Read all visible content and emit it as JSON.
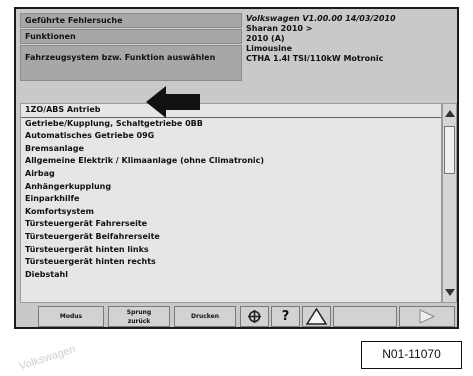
{
  "header": {
    "left": [
      "Geführte Fehlersuche",
      "Funktionen",
      "Fahrzeugsystem bzw. Funktion auswählen"
    ],
    "right": [
      "Volkswagen V1.00.00  14/03/2010",
      "Sharan 2010 >",
      "2010 (A)",
      "Limousine",
      "CTHA 1.4l TSI/110kW  Motronic"
    ]
  },
  "list": {
    "items": [
      "1ZO/ABS Antrieb",
      "Getriebe/Kupplung, Schaltgetriebe 0BB",
      "Automatisches Getriebe 09G",
      "Bremsanlage",
      "Allgemeine Elektrik / Klimaanlage (ohne Climatronic)",
      "Airbag",
      "Anhängerkupplung",
      "Einparkhilfe",
      "Komfortsystem",
      "Türsteuergerät Fahrerseite",
      "Türsteuergerät Beifahrerseite",
      "Türsteuergerät hinten links",
      "Türsteuergerät hinten rechts",
      "Diebstahl"
    ]
  },
  "toolbar": {
    "btn1": "Modus",
    "btn2a": "Sprung",
    "btn2b": "zurück",
    "btn3": "Drucken",
    "help_icon": "?"
  },
  "figure_ref": "N01-11070",
  "watermark": "Volkswagen"
}
